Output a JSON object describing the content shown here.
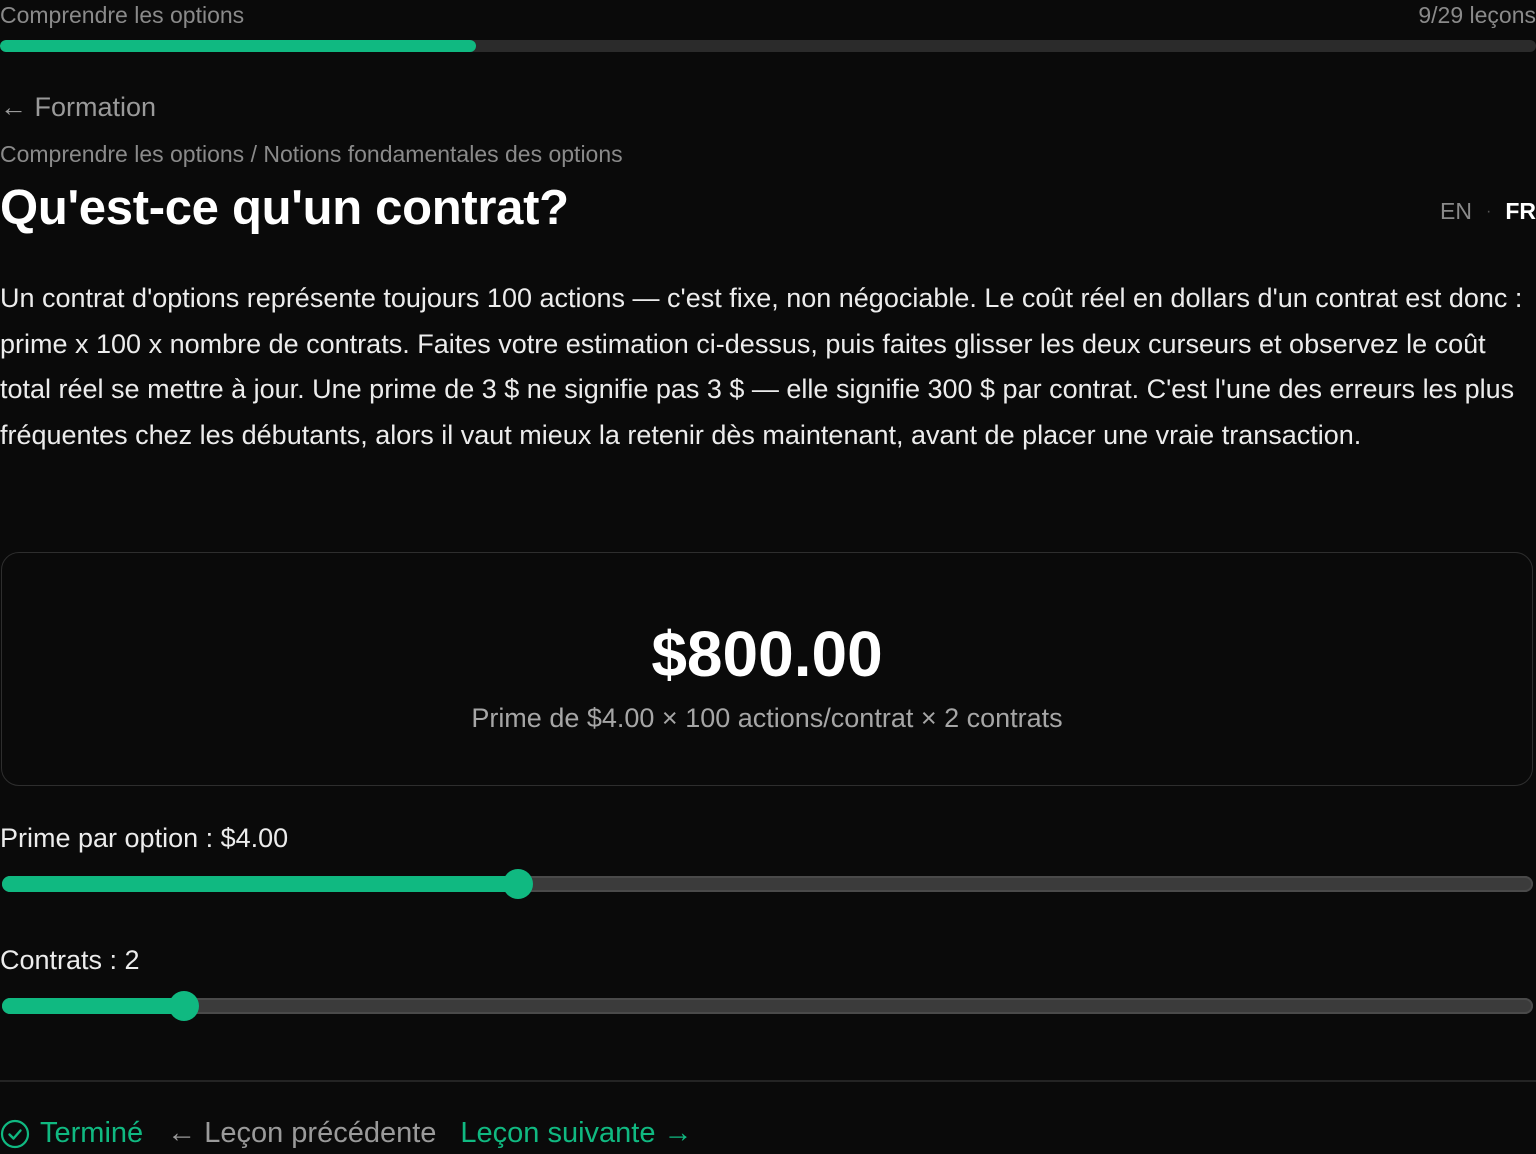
{
  "progress": {
    "course_name": "Comprendre les options",
    "lesson_count": "9/29 leçons",
    "fraction": 0.31
  },
  "nav": {
    "back_label": "← Formation",
    "breadcrumb": "Comprendre les options / Notions fondamentales des options"
  },
  "lesson": {
    "title": "Qu'est-ce qu'un contrat?",
    "body": "Un contrat d'options représente toujours 100 actions — c'est fixe, non négociable. Le coût réel en dollars d'un contrat est donc : prime x 100 x nombre de contrats. Faites votre estimation ci-dessus, puis faites glisser les deux curseurs et observez le coût total réel se mettre à jour. Une prime de 3 $ ne signifie pas 3 $ — elle signifie 300 $ par contrat. C'est l'une des erreurs les plus fréquentes chez les débutants, alors il vaut mieux la retenir dès maintenant, avant de placer une vraie transaction."
  },
  "language": {
    "en": "EN",
    "separator": "·",
    "fr": "FR",
    "active": "FR"
  },
  "calculator": {
    "total": "$800.00",
    "formula": "Prime de $4.00 × 100 actions/contrat × 2 contrats"
  },
  "sliders": {
    "premium": {
      "label": "Prime par option : $4.00",
      "fraction": 0.337
    },
    "contracts": {
      "label": "Contrats : 2",
      "fraction": 0.119
    }
  },
  "footer": {
    "done_label": "Terminé",
    "prev_label": "← Leçon précédente",
    "next_label": "Leçon suivante →"
  },
  "colors": {
    "accent": "#10b981",
    "background": "#0a0a0a"
  },
  "icons": {
    "done": "check-circle-icon"
  }
}
